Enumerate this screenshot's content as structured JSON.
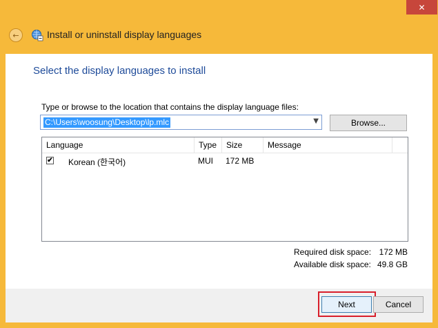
{
  "window": {
    "title": "Install or uninstall display languages",
    "close_glyph": "✕",
    "back_glyph": "←"
  },
  "main": {
    "heading": "Select the display languages to install",
    "path_label": "Type or browse to the location that contains the display language files:",
    "path_value": "C:\\Users\\woosung\\Desktop\\lp.mlc",
    "browse_label": "Browse..."
  },
  "table": {
    "columns": [
      "Language",
      "Type",
      "Size",
      "Message"
    ],
    "rows": [
      {
        "checked": "✔",
        "language": "Korean (한국어)",
        "type": "MUI",
        "size": "172 MB",
        "message": ""
      }
    ]
  },
  "disk": {
    "required_label": "Required disk space:",
    "required_value": "172 MB",
    "available_label": "Available disk space:",
    "available_value": "49.8 GB"
  },
  "footer": {
    "next_label": "Next",
    "cancel_label": "Cancel"
  },
  "colors": {
    "frame": "#f6b93a",
    "heading": "#1d4a99",
    "highlight": "#d81e2a",
    "selection": "#3399ff"
  }
}
